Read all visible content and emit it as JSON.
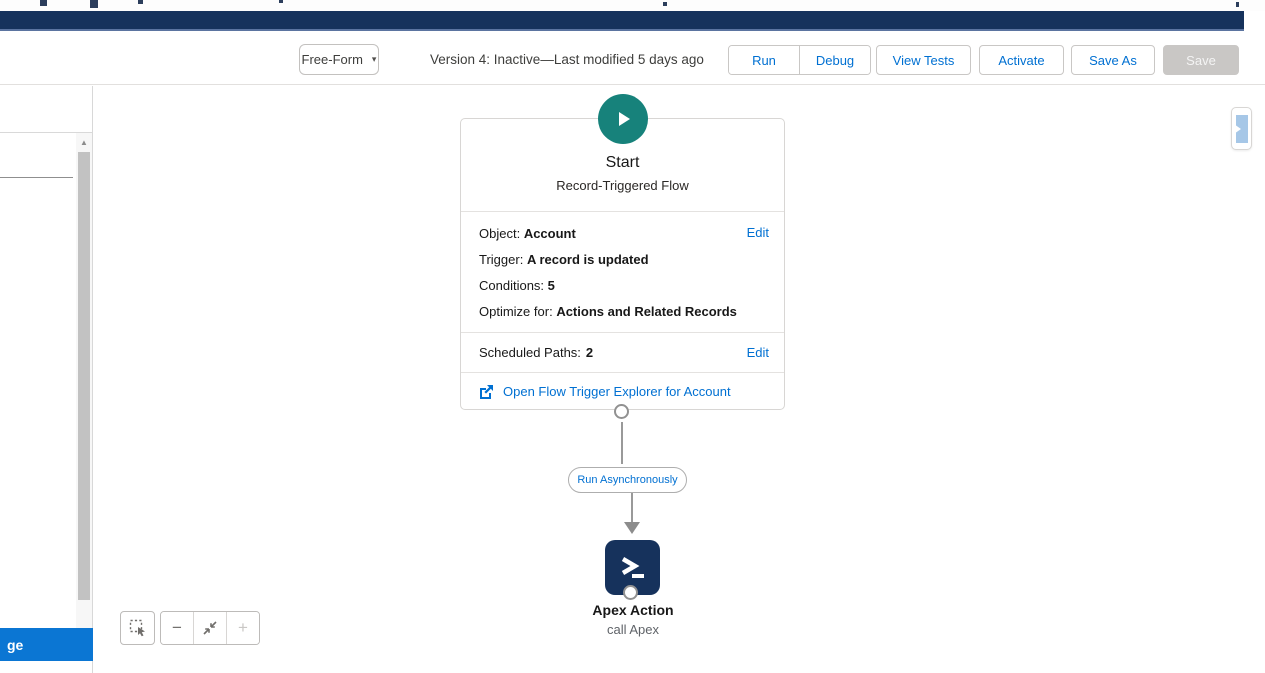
{
  "toolbar": {
    "layout_select": {
      "value": "Free-Form"
    },
    "version_status": "Version 4: Inactive—Last modified 5 days ago",
    "run": "Run",
    "debug": "Debug",
    "view_tests": "View Tests",
    "activate": "Activate",
    "save_as": "Save As",
    "save": "Save"
  },
  "toolbox": {
    "selected_item_text": "ge"
  },
  "canvas": {
    "start": {
      "title": "Start",
      "type_label": "Record-Triggered Flow",
      "rows": [
        {
          "label": "Object:",
          "value": "Account"
        },
        {
          "label": "Trigger:",
          "value": "A record is updated"
        },
        {
          "label": "Conditions:",
          "value": "5"
        },
        {
          "label": "Optimize for:",
          "value": "Actions and Related Records"
        }
      ],
      "edit": "Edit",
      "scheduled_paths": {
        "label": "Scheduled Paths:",
        "value": "2",
        "edit": "Edit"
      },
      "explorer_link": "Open Flow Trigger Explorer for Account"
    },
    "connector_label": "Run Asynchronously",
    "apex": {
      "title": "Apex Action",
      "name": "call Apex"
    }
  },
  "icons": {
    "caret": "▾",
    "scroll_up": "▲",
    "minus": "−",
    "plus": "+"
  },
  "colors": {
    "navy": "#16325c",
    "accent_blue": "#0070d2",
    "start_teal": "#17827b",
    "selected_blue": "#0b76d3",
    "disabled_gray": "#c9c7c5"
  }
}
